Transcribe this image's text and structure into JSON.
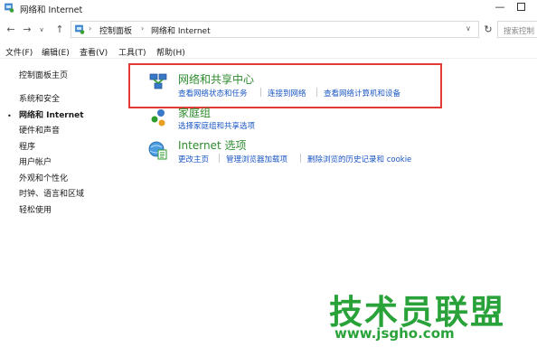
{
  "window": {
    "title": "网络和 Internet",
    "minimize_glyph": "—"
  },
  "nav": {
    "back_glyph": "←",
    "forward_glyph": "→",
    "dropdown_glyph": "∨",
    "up_glyph": "↑"
  },
  "address": {
    "breadcrumbs": [
      "控制面板",
      "网络和 Internet"
    ],
    "separator": "›",
    "dropdown_glyph": "∨",
    "refresh_glyph": "↻",
    "search_placeholder": "搜索控制"
  },
  "menu": [
    "文件(F)",
    "编辑(E)",
    "查看(V)",
    "工具(T)",
    "帮助(H)"
  ],
  "sidebar": {
    "items": [
      "控制面板主页",
      "系统和安全",
      "网络和 Internet",
      "硬件和声音",
      "程序",
      "用户帐户",
      "外观和个性化",
      "时钟、语言和区域",
      "轻松使用"
    ],
    "active_index": 2,
    "bullet": "•"
  },
  "categories": [
    {
      "title": "网络和共享中心",
      "icon": "network-share-center-icon",
      "links": [
        "查看网络状态和任务",
        "连接到网络",
        "查看网络计算机和设备"
      ]
    },
    {
      "title": "家庭组",
      "icon": "homegroup-icon",
      "links": [
        "选择家庭组和共享选项"
      ]
    },
    {
      "title": "Internet 选项",
      "icon": "internet-options-icon",
      "links": [
        "更改主页",
        "管理浏览器加载项",
        "删除浏览的历史记录和 cookie"
      ]
    }
  ],
  "watermark": {
    "text": "技术员联盟",
    "url": "www.jsgho.com"
  },
  "colors": {
    "highlight": "#e53935",
    "title_green": "#2e8b2e",
    "link_blue": "#1a56c4",
    "watermark_green": "#2aa23a"
  }
}
